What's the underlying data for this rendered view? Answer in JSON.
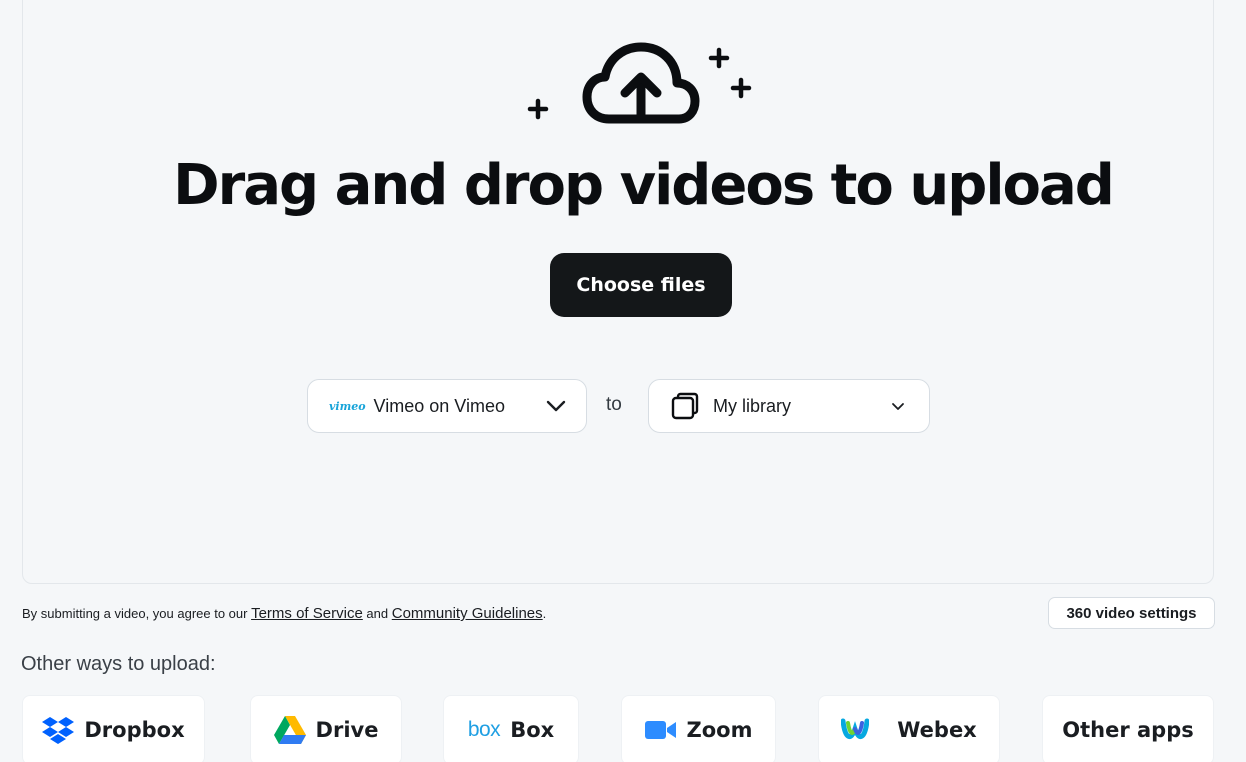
{
  "dropzone": {
    "headline": "Drag and drop videos to upload",
    "choose_files_label": "Choose files",
    "source_select": {
      "logo_text": "vimeo",
      "value": "Vimeo on Vimeo"
    },
    "to_word": "to",
    "dest_select": {
      "value": "My library"
    }
  },
  "legal": {
    "prefix": "By submitting a video, you agree to our",
    "terms_link": "Terms of Service",
    "and": "and",
    "guidelines_link": "Community Guidelines",
    "suffix": "."
  },
  "settings_360_label": "360 video settings",
  "other_ways": {
    "title": "Other ways to upload:",
    "apps": [
      {
        "label": "Dropbox",
        "icon": "dropbox-icon"
      },
      {
        "label": "Drive",
        "icon": "google-drive-icon"
      },
      {
        "label": "Box",
        "icon": "box-icon",
        "logo_text": "box"
      },
      {
        "label": "Zoom",
        "icon": "zoom-icon"
      },
      {
        "label": "Webex",
        "icon": "webex-icon"
      },
      {
        "label": "Other apps",
        "icon": ""
      }
    ]
  },
  "colors": {
    "background": "#f5f7f9",
    "button_dark": "#141719",
    "dropbox": "#0061fe",
    "zoom": "#2d8cff",
    "box": "#1f9fe3",
    "vimeo": "#17a4d9"
  }
}
